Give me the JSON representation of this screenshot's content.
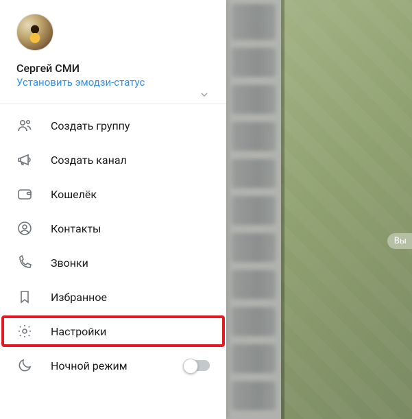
{
  "profile": {
    "username": "Сергей СМИ",
    "status_link": "Установить эмодзи-статус"
  },
  "menu": {
    "create_group": "Создать группу",
    "create_channel": "Создать канал",
    "wallet": "Кошелёк",
    "contacts": "Контакты",
    "calls": "Звонки",
    "saved": "Избранное",
    "settings": "Настройки",
    "night_mode": "Ночной режим"
  },
  "pill": "Вы",
  "colors": {
    "accent": "#3390ec",
    "highlight": "#e01b24"
  }
}
